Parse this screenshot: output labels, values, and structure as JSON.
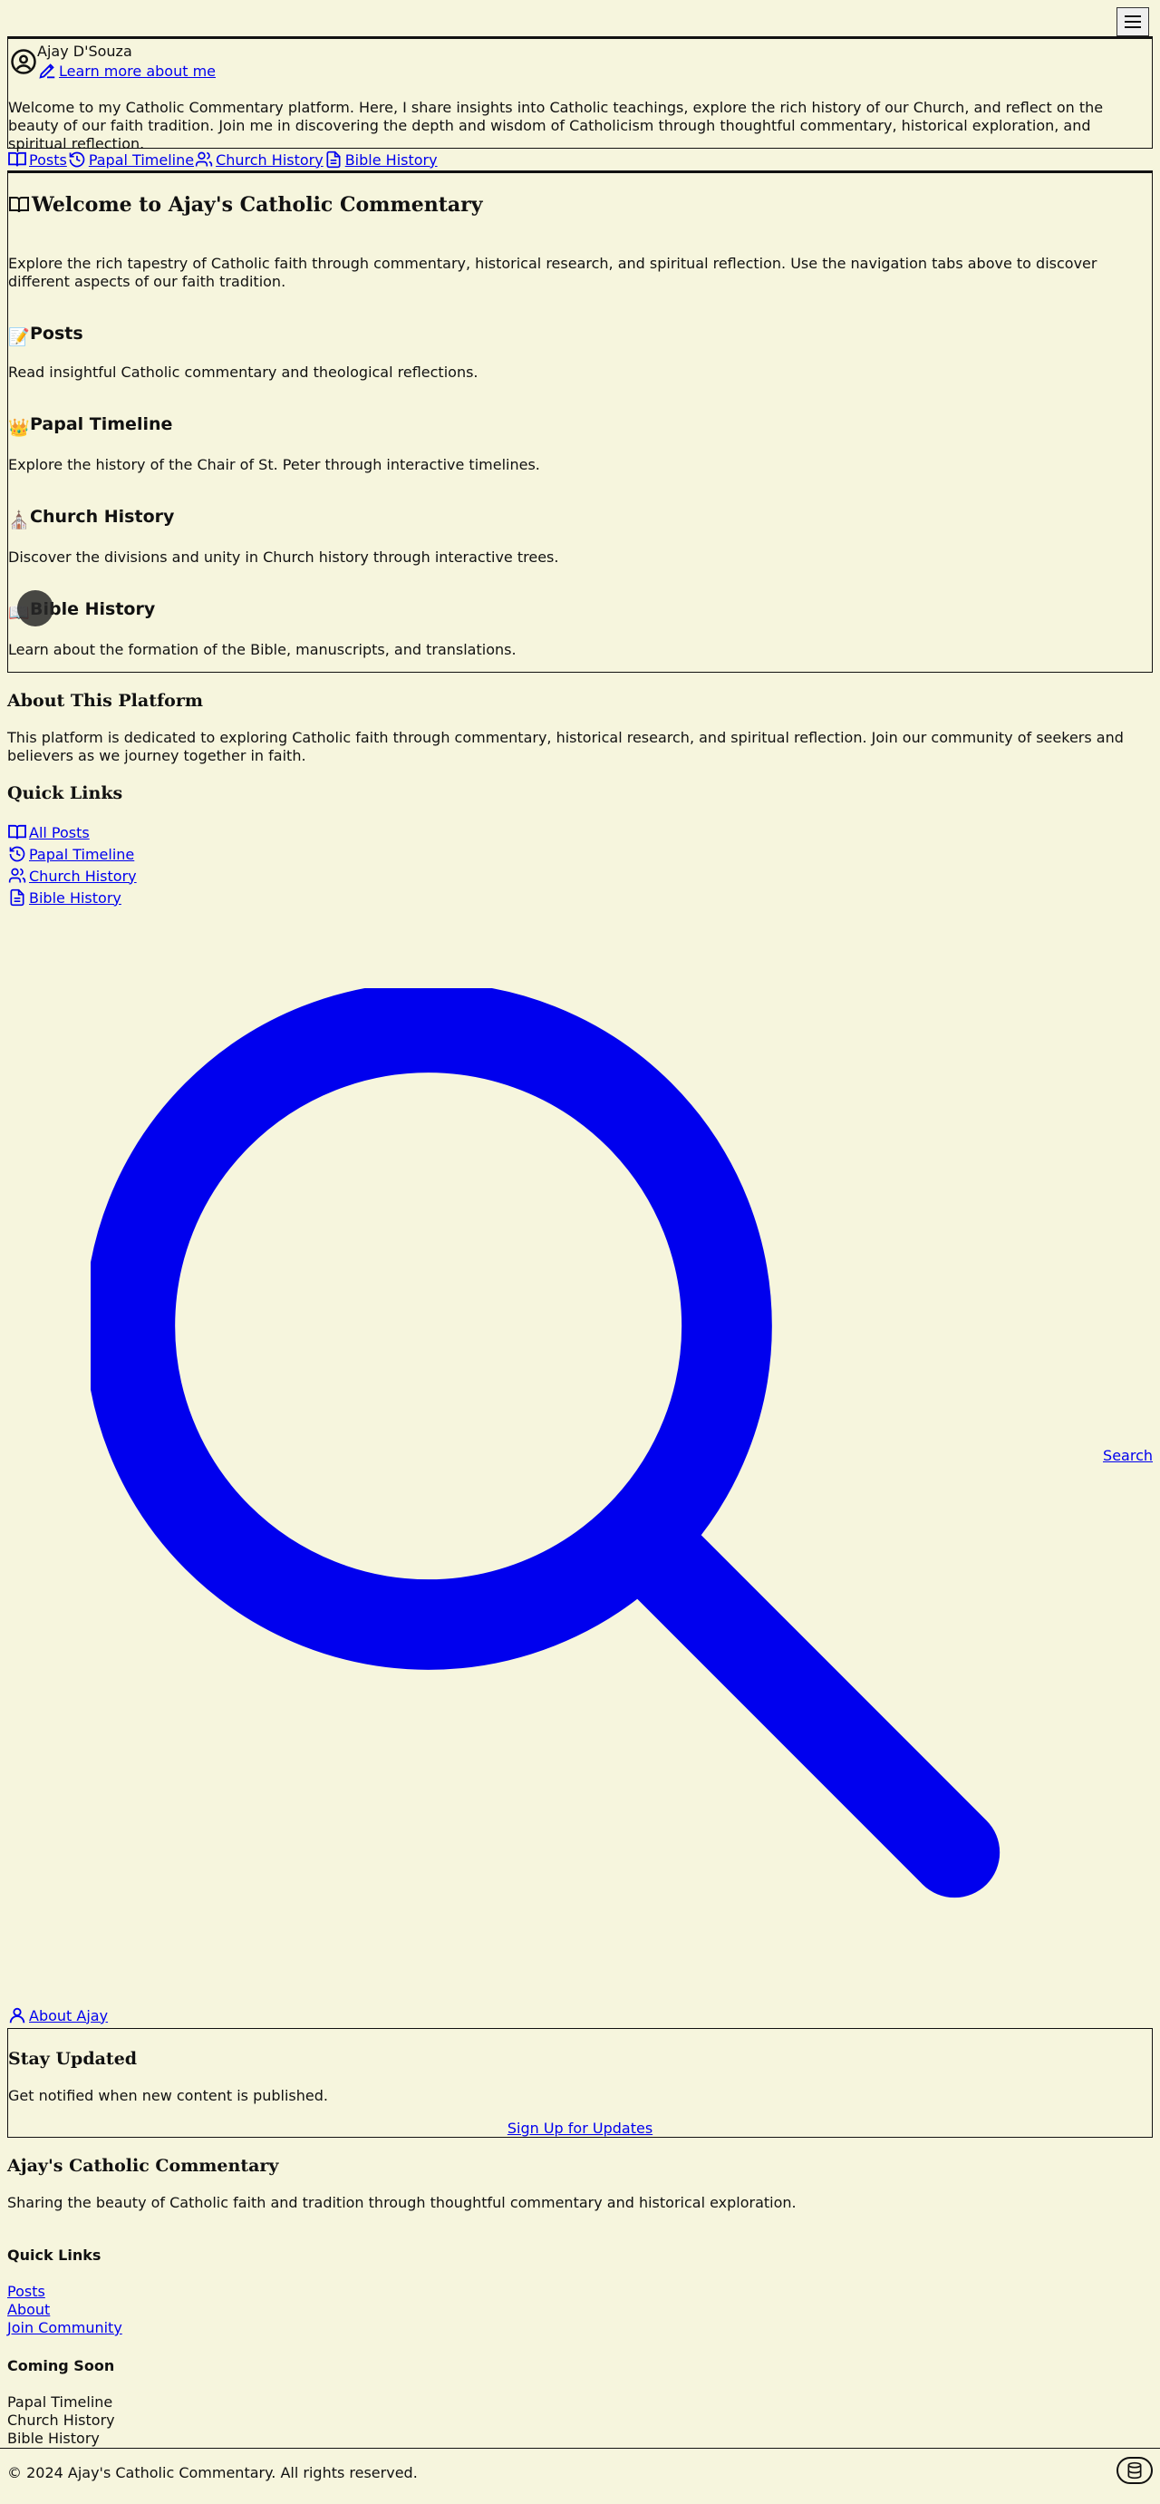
{
  "header": {
    "menu_icon": "hamburger-icon"
  },
  "profile": {
    "author_name": "Ajay D'Souza",
    "learn_more": "Learn more about me",
    "intro": "Welcome to my Catholic Commentary platform. Here, I share insights into Catholic teachings, explore the rich history of our Church, and reflect on the beauty of our faith tradition. Join me in discovering the depth and wisdom of Catholicism through thoughtful commentary, historical exploration, and spiritual reflection."
  },
  "tabs": [
    {
      "label": "Posts",
      "icon": "book-open-icon"
    },
    {
      "label": "Papal Timeline",
      "icon": "history-icon"
    },
    {
      "label": "Church History",
      "icon": "users-icon"
    },
    {
      "label": "Bible History",
      "icon": "file-text-icon"
    }
  ],
  "welcome": {
    "title": "Welcome to Ajay's Catholic Commentary",
    "description": "Explore the rich tapestry of Catholic faith through commentary, historical research, and spiritual reflection. Use the navigation tabs above to discover different aspects of our faith tradition.",
    "sections": [
      {
        "emoji": "📝",
        "title": "Posts",
        "text": "Read insightful Catholic commentary and theological reflections."
      },
      {
        "emoji": "👑",
        "title": "Papal Timeline",
        "text": "Explore the history of the Chair of St. Peter through interactive timelines."
      },
      {
        "emoji": "⛪",
        "title": "Church History",
        "text": "Discover the divisions and unity in Church history through interactive trees."
      },
      {
        "emoji": "📖",
        "title": "Bible History",
        "text": "Learn about the formation of the Bible, manuscripts, and translations."
      }
    ]
  },
  "about": {
    "heading": "About This Platform",
    "text": "This platform is dedicated to exploring Catholic faith through commentary, historical research, and spiritual reflection. Join our community of seekers and believers as we journey together in faith."
  },
  "quick_links": {
    "heading": "Quick Links",
    "items": [
      {
        "label": "All Posts",
        "icon": "book-open-icon"
      },
      {
        "label": "Papal Timeline",
        "icon": "history-icon"
      },
      {
        "label": "Church History",
        "icon": "users-icon"
      },
      {
        "label": "Bible History",
        "icon": "file-text-icon"
      }
    ]
  },
  "search": {
    "label": "Search",
    "icon": "search-icon",
    "color": "#0000ee"
  },
  "about_ajay": {
    "label": "About Ajay",
    "icon": "user-icon"
  },
  "stay_updated": {
    "heading": "Stay Updated",
    "text": "Get notified when new content is published.",
    "signup": "Sign Up for Updates"
  },
  "footer": {
    "brand": "Ajay's Catholic Commentary",
    "tagline": "Sharing the beauty of Catholic faith and tradition through thoughtful commentary and historical exploration.",
    "quick_links_heading": "Quick Links",
    "quick_links": [
      "Posts",
      "About",
      "Join Community"
    ],
    "coming_soon_heading": "Coming Soon",
    "coming_soon": [
      "Papal Timeline",
      "Church History",
      "Bible History"
    ],
    "copyright": "© 2024 Ajay's Catholic Commentary. All rights reserved.",
    "db_icon": "database-icon"
  },
  "colors": {
    "background": "#f6f5dd",
    "link": "#0000ee",
    "text": "#111111"
  }
}
